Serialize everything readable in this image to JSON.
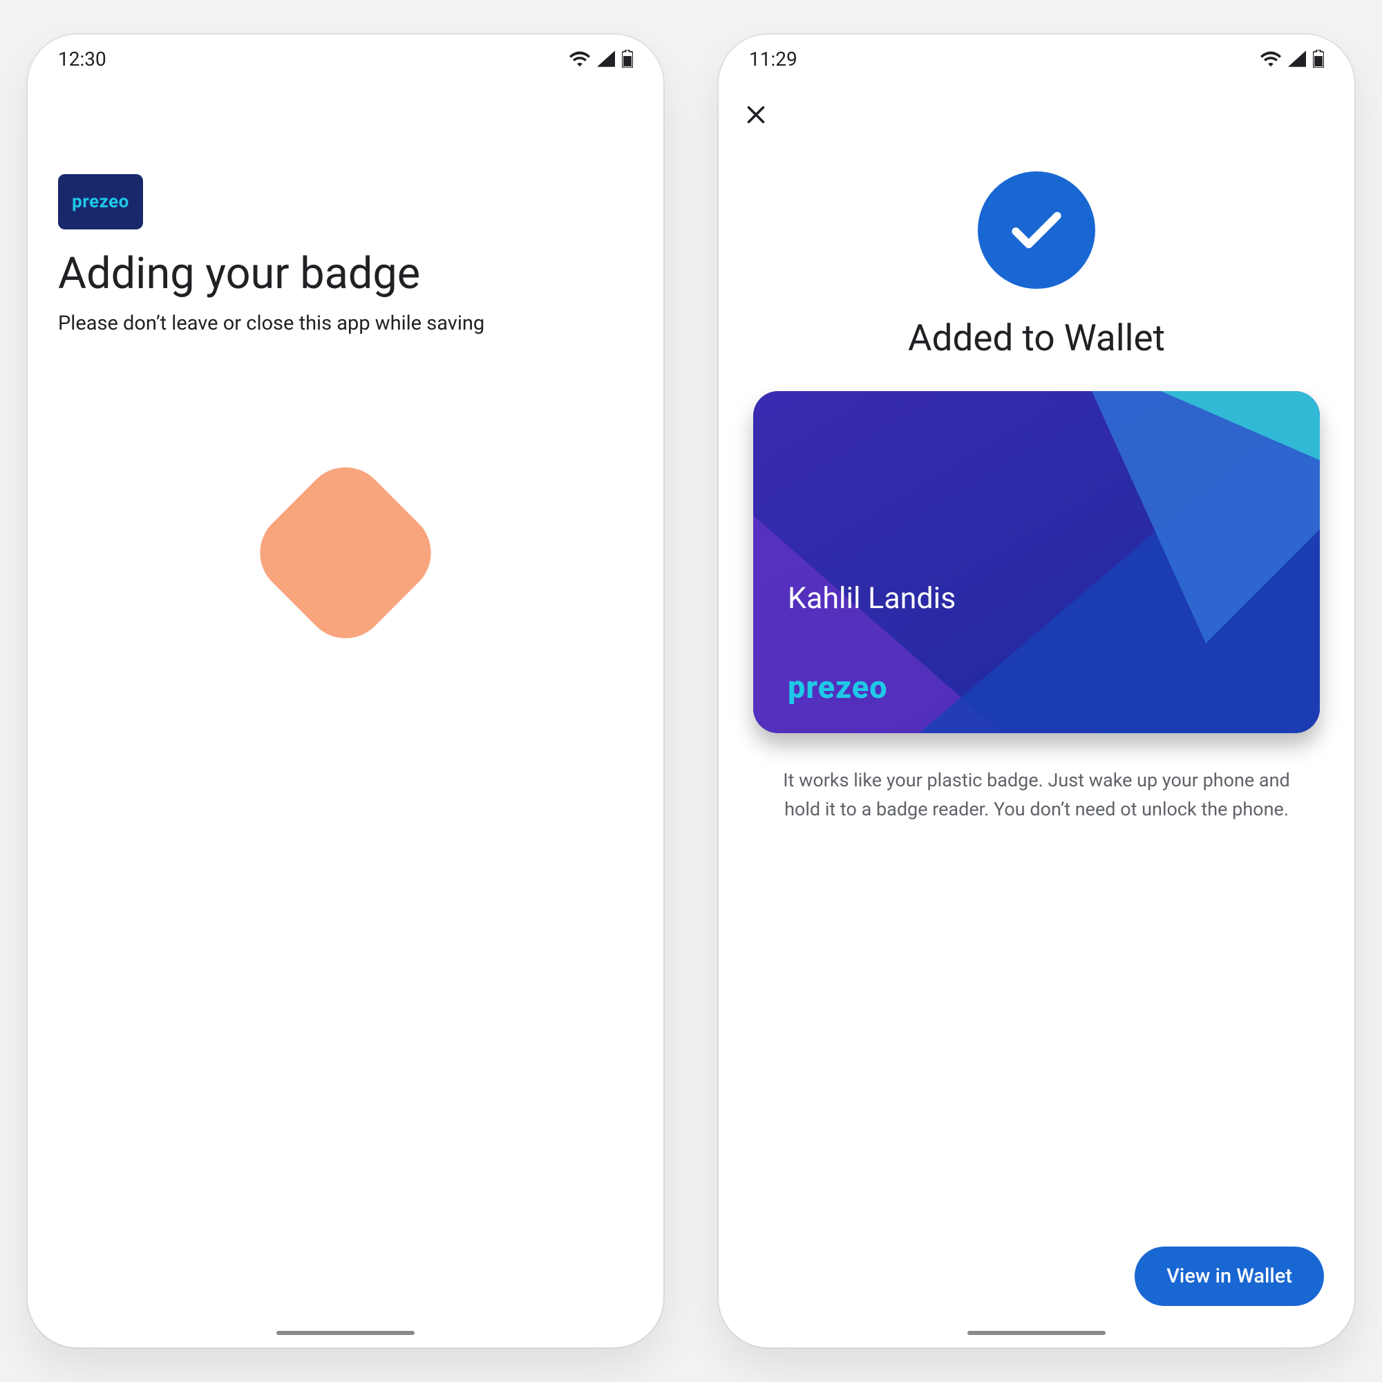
{
  "screens": {
    "loading": {
      "statusbar": {
        "time": "12:30"
      },
      "brand_label": "prezeo",
      "title": "Adding your badge",
      "subtitle": "Please don’t leave or close this app while saving",
      "icons": {
        "loader": "diamond-loader-icon"
      }
    },
    "success": {
      "statusbar": {
        "time": "11:29"
      },
      "title": "Added to Wallet",
      "badge": {
        "holder_name": "Kahlil Landis",
        "brand_label": "prezeo"
      },
      "description": "It works like your plastic badge. Just wake up your phone and hold it to a badge reader. You don’t need ot unlock the phone.",
      "cta_label": "View in Wallet",
      "icons": {
        "close": "close-icon",
        "check": "check-circle-icon"
      }
    }
  },
  "colors": {
    "blue": "#1967d2",
    "brand_navy": "#18286b",
    "brand_cyan": "#1ec9e8",
    "loader_orange": "#f8a57d"
  }
}
